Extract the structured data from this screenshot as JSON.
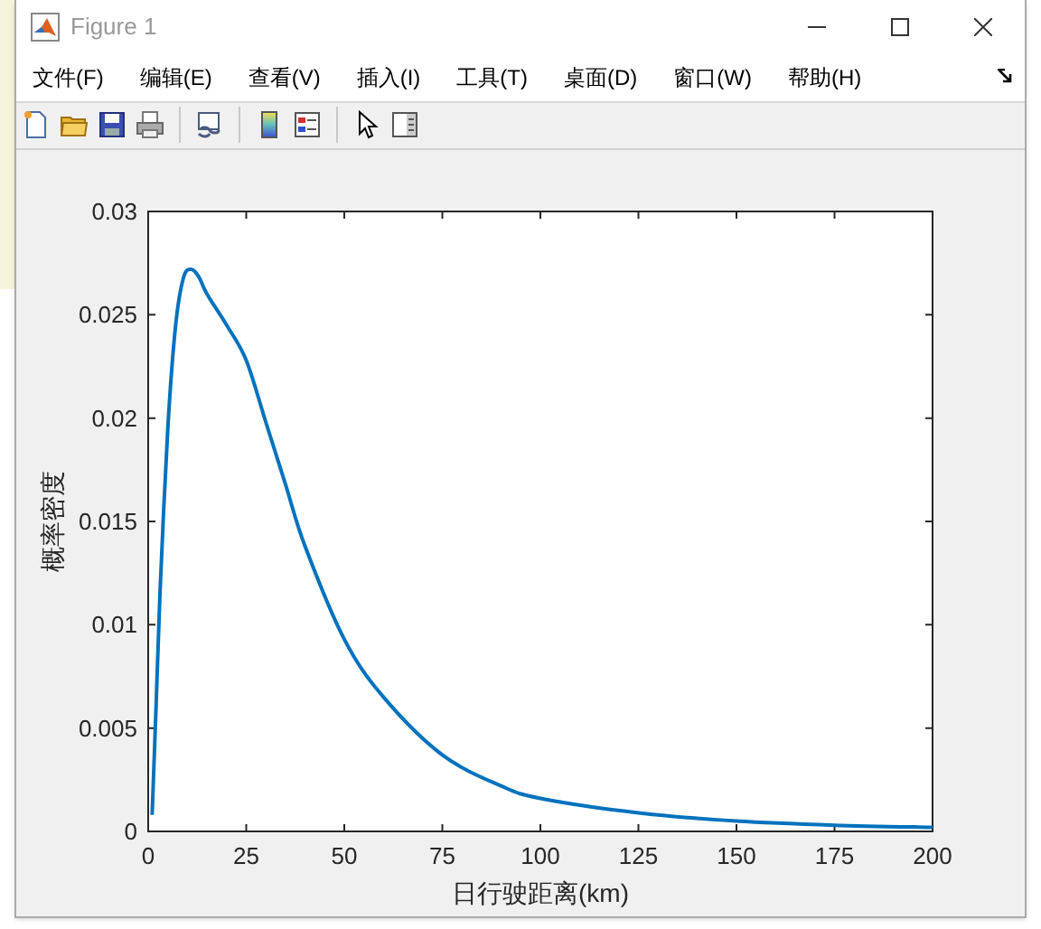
{
  "window": {
    "title": "Figure 1"
  },
  "menu": [
    "文件(F)",
    "编辑(E)",
    "查看(V)",
    "插入(I)",
    "工具(T)",
    "桌面(D)",
    "窗口(W)",
    "帮助(H)"
  ],
  "toolbar": [
    {
      "kind": "new"
    },
    {
      "kind": "open"
    },
    {
      "kind": "save"
    },
    {
      "kind": "print"
    },
    {
      "kind": "separator"
    },
    {
      "kind": "link"
    },
    {
      "kind": "separator"
    },
    {
      "kind": "colorbar"
    },
    {
      "kind": "legend"
    },
    {
      "kind": "separator"
    },
    {
      "kind": "pointer"
    },
    {
      "kind": "inspector"
    }
  ],
  "plot": {
    "chart_data": {
      "type": "line",
      "xlabel": "日行驶距离(km)",
      "ylabel": "概率密度",
      "x": [
        1,
        2,
        3,
        5,
        7,
        9,
        11,
        13,
        15,
        20,
        25,
        30,
        35,
        40,
        50,
        60,
        75,
        90,
        100,
        125,
        150,
        175,
        200
      ],
      "series": [
        {
          "color": "#0072bd",
          "values": [
            0.0008,
            0.006,
            0.0115,
            0.0195,
            0.0245,
            0.0268,
            0.0272,
            0.0268,
            0.026,
            0.0245,
            0.0228,
            0.0198,
            0.0168,
            0.0138,
            0.0093,
            0.0065,
            0.0037,
            0.0022,
            0.0016,
            0.0009,
            0.0005,
            0.0003,
            0.0002
          ]
        }
      ],
      "xlim": [
        0,
        200
      ],
      "ylim": [
        0,
        0.03
      ],
      "xticks": [
        0,
        25,
        50,
        75,
        100,
        125,
        150,
        175,
        200
      ],
      "yticks": [
        {
          "value": 0,
          "label": "0"
        },
        {
          "value": 0.005,
          "label": "0.005"
        },
        {
          "value": 0.01,
          "label": "0.01"
        },
        {
          "value": 0.015,
          "label": "0.015"
        },
        {
          "value": 0.02,
          "label": "0.02"
        },
        {
          "value": 0.025,
          "label": "0.025"
        },
        {
          "value": 0.03,
          "label": "0.03"
        }
      ]
    }
  }
}
